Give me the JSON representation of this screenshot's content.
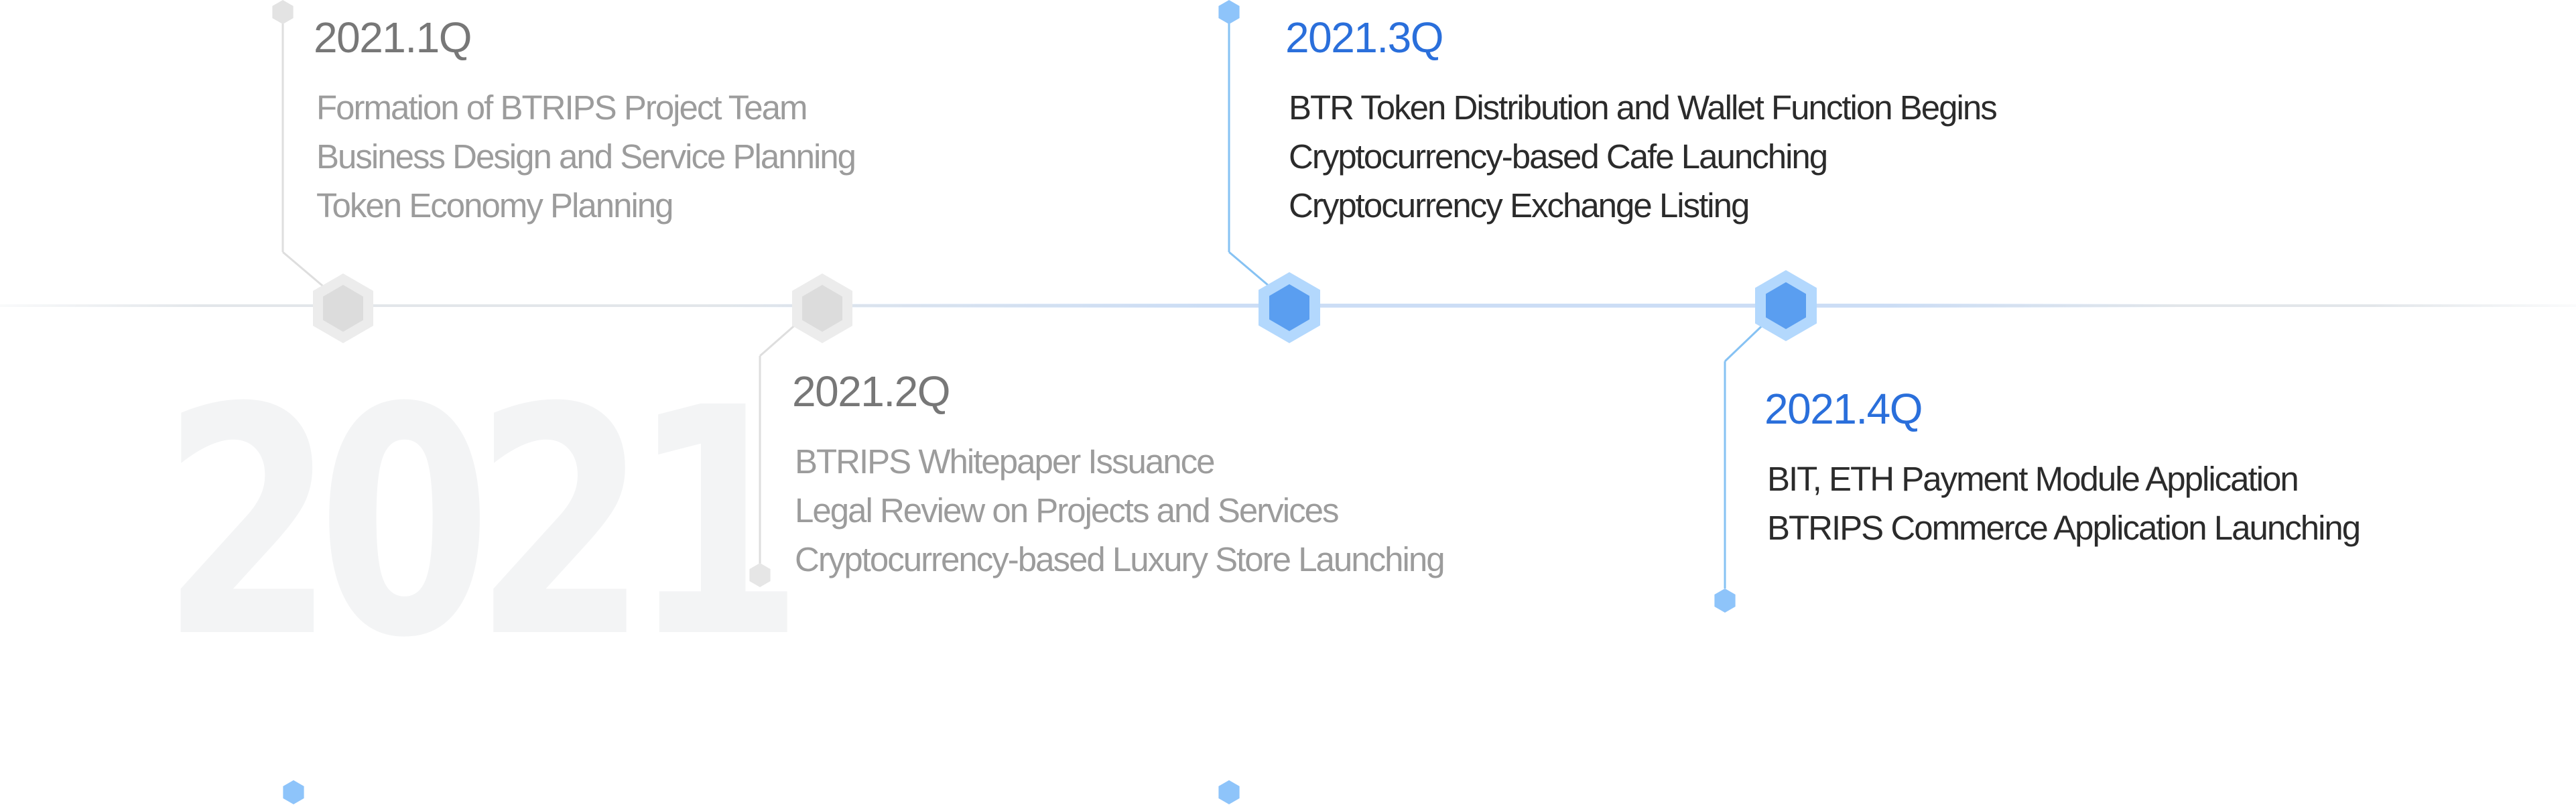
{
  "year": "2021",
  "colors": {
    "past_period": "#777777",
    "past_text": "#9c9c9c",
    "current_period": "#2a6fdb",
    "current_text": "#2b2b2b",
    "past_marker": "#d9d9d9",
    "current_marker": "#6aaef8",
    "watermark": "#f3f4f5"
  },
  "milestones": [
    {
      "period": "2021.1Q",
      "status": "completed",
      "items": [
        "Formation of BTRIPS Project Team",
        "Business Design and Service Planning",
        "Token Economy Planning"
      ]
    },
    {
      "period": "2021.2Q",
      "status": "completed",
      "items": [
        "BTRIPS Whitepaper Issuance",
        "Legal Review on Projects and Services",
        "Cryptocurrency-based Luxury Store Launching"
      ]
    },
    {
      "period": "2021.3Q",
      "status": "current",
      "items": [
        "BTR Token Distribution and Wallet Function Begins",
        "Cryptocurrency-based Cafe Launching",
        "Cryptocurrency Exchange Listing"
      ]
    },
    {
      "period": "2021.4Q",
      "status": "current",
      "items": [
        "BIT, ETH Payment Module Application",
        "BTRIPS Commerce Application Launching"
      ]
    }
  ]
}
